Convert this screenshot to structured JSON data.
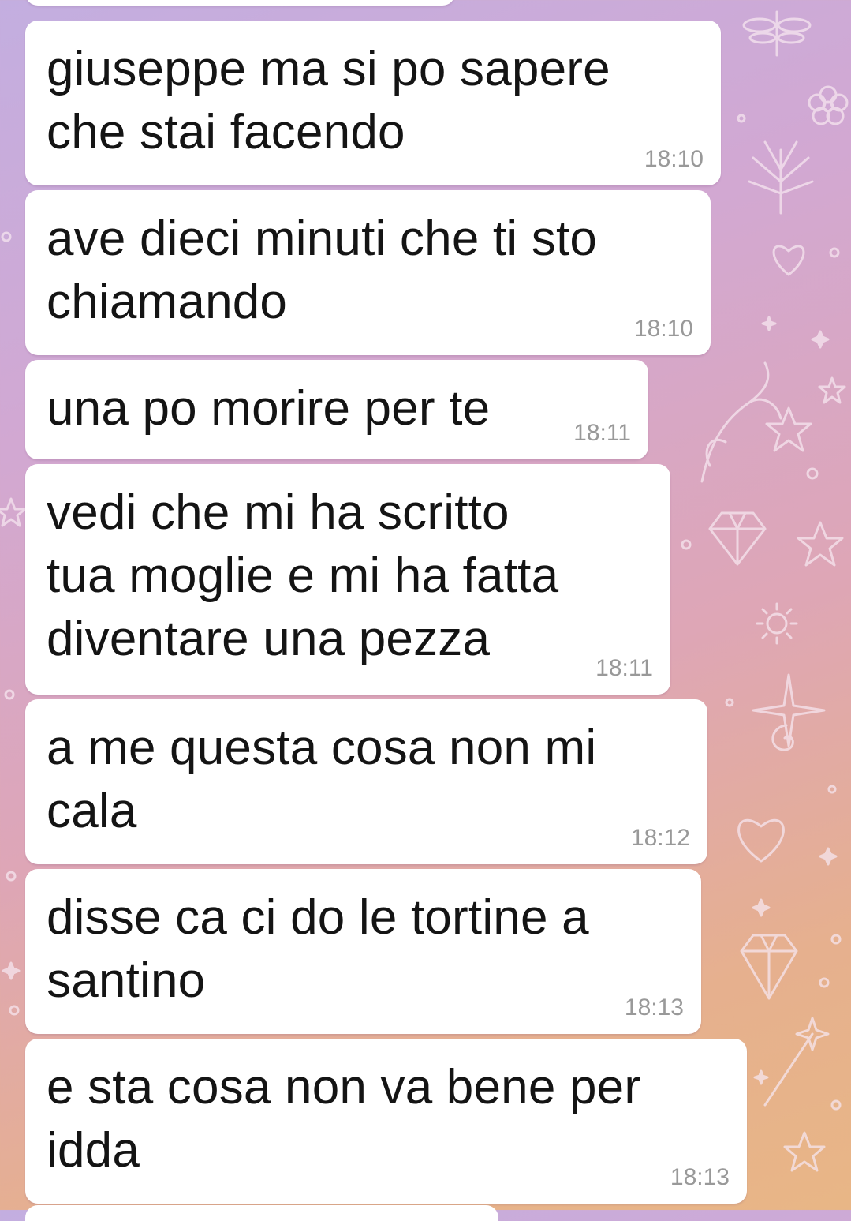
{
  "chat": {
    "messages": [
      {
        "text": "giuseppe ma si po sapere\nche stai facendo",
        "time": "18:10"
      },
      {
        "text": "ave dieci minuti che ti sto\nchiamando",
        "time": "18:10"
      },
      {
        "text": "una po morire per te",
        "time": "18:11"
      },
      {
        "text": "vedi che mi ha scritto\ntua moglie e mi ha fatta\ndiventare una pezza",
        "time": "18:11"
      },
      {
        "text": "a me questa cosa non mi\ncala",
        "time": "18:12"
      },
      {
        "text": "disse ca ci do le tortine a\nsantino",
        "time": "18:13"
      },
      {
        "text": "e sta cosa non va bene per\nidda",
        "time": "18:13"
      }
    ]
  },
  "theme": {
    "bubble_color": "#ffffff",
    "text_color": "#141414",
    "time_color": "#999999",
    "background_icons": [
      "star-icon",
      "heart-icon",
      "diamond-icon",
      "flower-icon",
      "leaf-icon",
      "sun-icon",
      "unicorn-icon",
      "magic-wand-icon",
      "dragonfly-icon"
    ]
  }
}
